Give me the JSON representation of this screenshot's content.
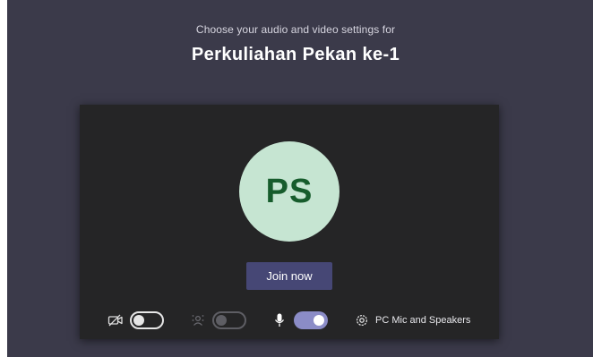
{
  "header": {
    "subtitle": "Choose your audio and video settings for",
    "meeting_title": "Perkuliahan Pekan ke-1"
  },
  "preview": {
    "avatar_initials": "PS",
    "join_label": "Join now"
  },
  "controls": {
    "camera": {
      "icon": "camera-off-icon",
      "state": "off"
    },
    "background_effects": {
      "icon": "background-blur-icon",
      "state": "disabled"
    },
    "microphone": {
      "icon": "microphone-icon",
      "state": "on"
    },
    "audio_device": {
      "icon": "gear-icon",
      "label": "PC Mic and Speakers"
    }
  },
  "colors": {
    "page_background": "#3b3a4a",
    "preview_background": "#252526",
    "avatar_background": "#c6e5d2",
    "avatar_text": "#165c2c",
    "join_button": "#464775",
    "toggle_on": "#8b8cc7"
  }
}
